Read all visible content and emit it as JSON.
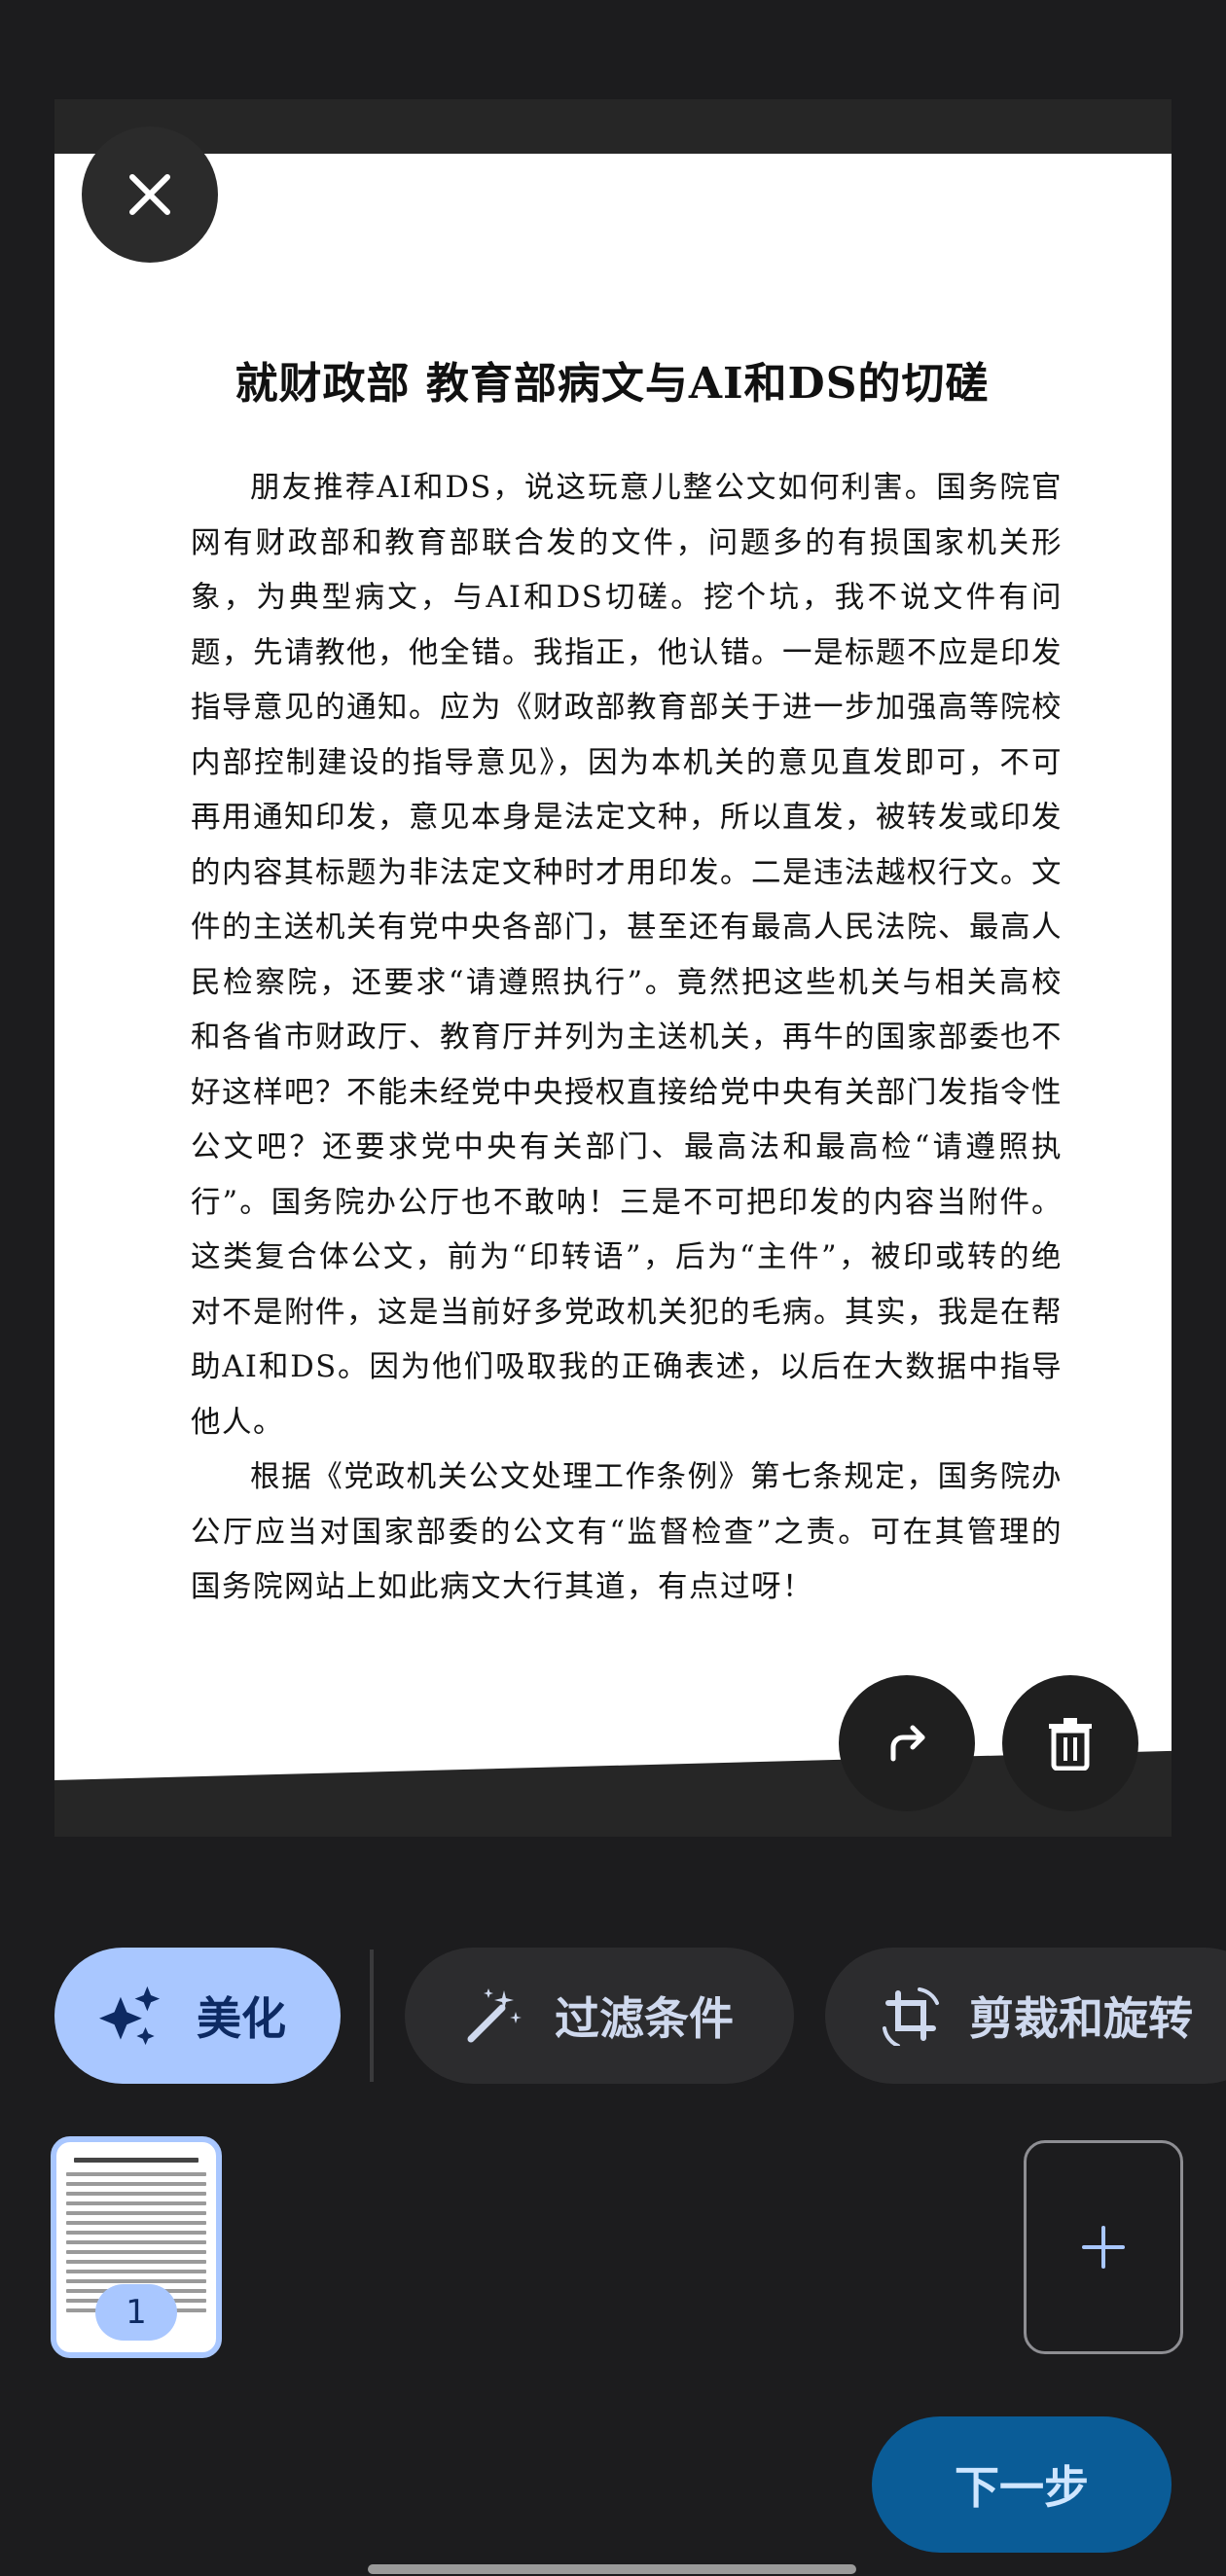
{
  "document": {
    "title": "就财政部 教育部病文与AI和DS的切磋",
    "paragraphs": [
      "朋友推荐AI和DS，说这玩意儿整公文如何利害。国务院官网有财政部和教育部联合发的文件，问题多的有损国家机关形象，为典型病文，与AI和DS切磋。挖个坑，我不说文件有问题，先请教他，他全错。我指正，他认错。一是标题不应是印发指导意见的通知。应为《财政部教育部关于进一步加强高等院校内部控制建设的指导意见》，因为本机关的意见直发即可，不可再用通知印发，意见本身是法定文种，所以直发，被转发或印发的内容其标题为非法定文种时才用印发。二是违法越权行文。文件的主送机关有党中央各部门，甚至还有最高人民法院、最高人民检察院，还要求“请遵照执行”。竟然把这些机关与相关高校和各省市财政厅、教育厅并列为主送机关，再牛的国家部委也不好这样吧？不能未经党中央授权直接给党中央有关部门发指令性公文吧？还要求党中央有关部门、最高法和最高检“请遵照执行”。国务院办公厅也不敢呐！三是不可把印发的内容当附件。这类复合体公文，前为“印转语”，后为“主件”，被印或转的绝对不是附件，这是当前好多党政机关犯的毛病。其实，我是在帮助AI和DS。因为他们吸取我的正确表述，以后在大数据中指导他人。",
      "根据《党政机关公文处理工作条例》第七条规定，国务院办公厅应当对国家部委的公文有“监督检查”之责。可在其管理的国务院网站上如此病文大行其道，有点过呀！"
    ]
  },
  "toolbar": {
    "beautify_label": "美化",
    "filter_label": "过滤条件",
    "crop_rotate_label": "剪裁和旋转"
  },
  "pages": {
    "thumbnail_number": "1"
  },
  "actions": {
    "add_page_symbol": "+",
    "next_label": "下一步"
  },
  "icons": {
    "close": "close-icon",
    "rotate": "rotate-icon",
    "delete": "trash-icon",
    "beautify": "sparkle-icon",
    "filter": "magic-wand-icon",
    "crop": "crop-rotate-icon"
  },
  "colors": {
    "background": "#1c1c1e",
    "accent": "#a9c7ff",
    "primary_button": "#0a5c97"
  }
}
